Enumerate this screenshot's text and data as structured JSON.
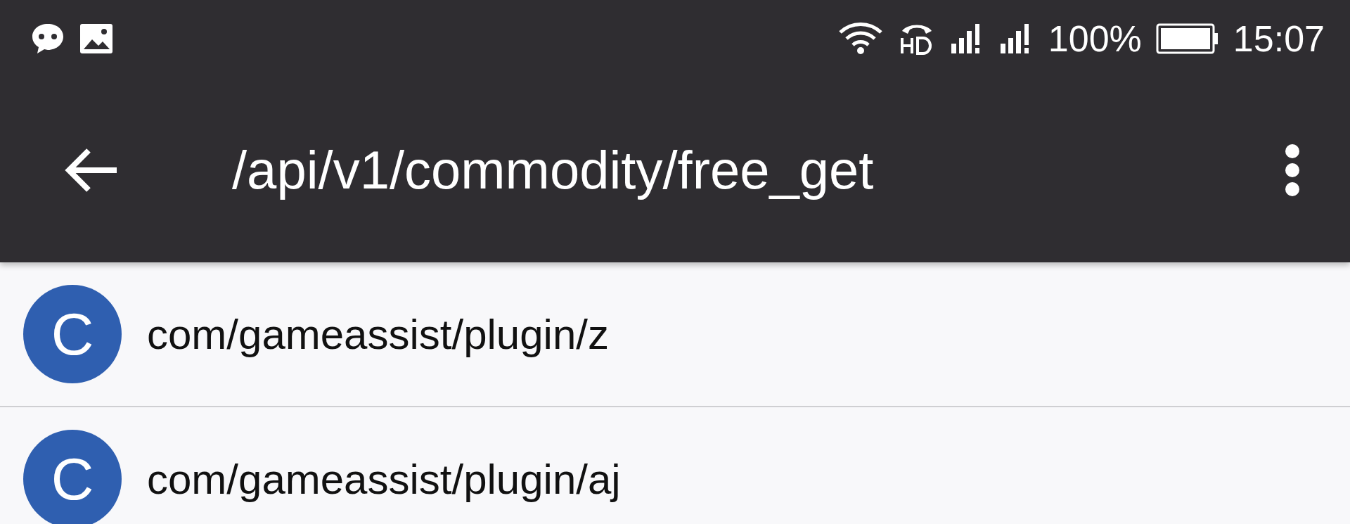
{
  "status_bar": {
    "battery": "100%",
    "time": "15:07"
  },
  "app_bar": {
    "title": "/api/v1/commodity/free_get"
  },
  "items": [
    {
      "avatar": "C",
      "label": "com/gameassist/plugin/z"
    },
    {
      "avatar": "C",
      "label": "com/gameassist/plugin/aj"
    }
  ]
}
